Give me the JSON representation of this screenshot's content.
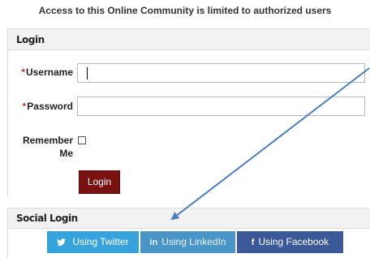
{
  "notice": "Access to this Online Community is limited to authorized users",
  "login": {
    "heading": "Login",
    "required_mark": "*",
    "username_label": "Username",
    "username_value": "",
    "password_label": "Password",
    "password_value": "",
    "remember_label_line1": "Remember",
    "remember_label_line2": "Me",
    "remember_checked": false,
    "submit_label": "Login"
  },
  "social": {
    "heading": "Social Login",
    "buttons": [
      {
        "icon": "twitter-icon",
        "glyph": "🐦",
        "label": "Using Twitter",
        "color": "#36a3dc"
      },
      {
        "icon": "linkedin-icon",
        "glyph": "in",
        "label": "Using LinkedIn",
        "color": "#4a95c7"
      },
      {
        "icon": "facebook-icon",
        "glyph": "f",
        "label": "Using Facebook",
        "color": "#3b5998"
      }
    ]
  },
  "colors": {
    "login_button": "#7a1111",
    "required": "#c0392b",
    "annotation_arrow": "#4a7fbf"
  }
}
